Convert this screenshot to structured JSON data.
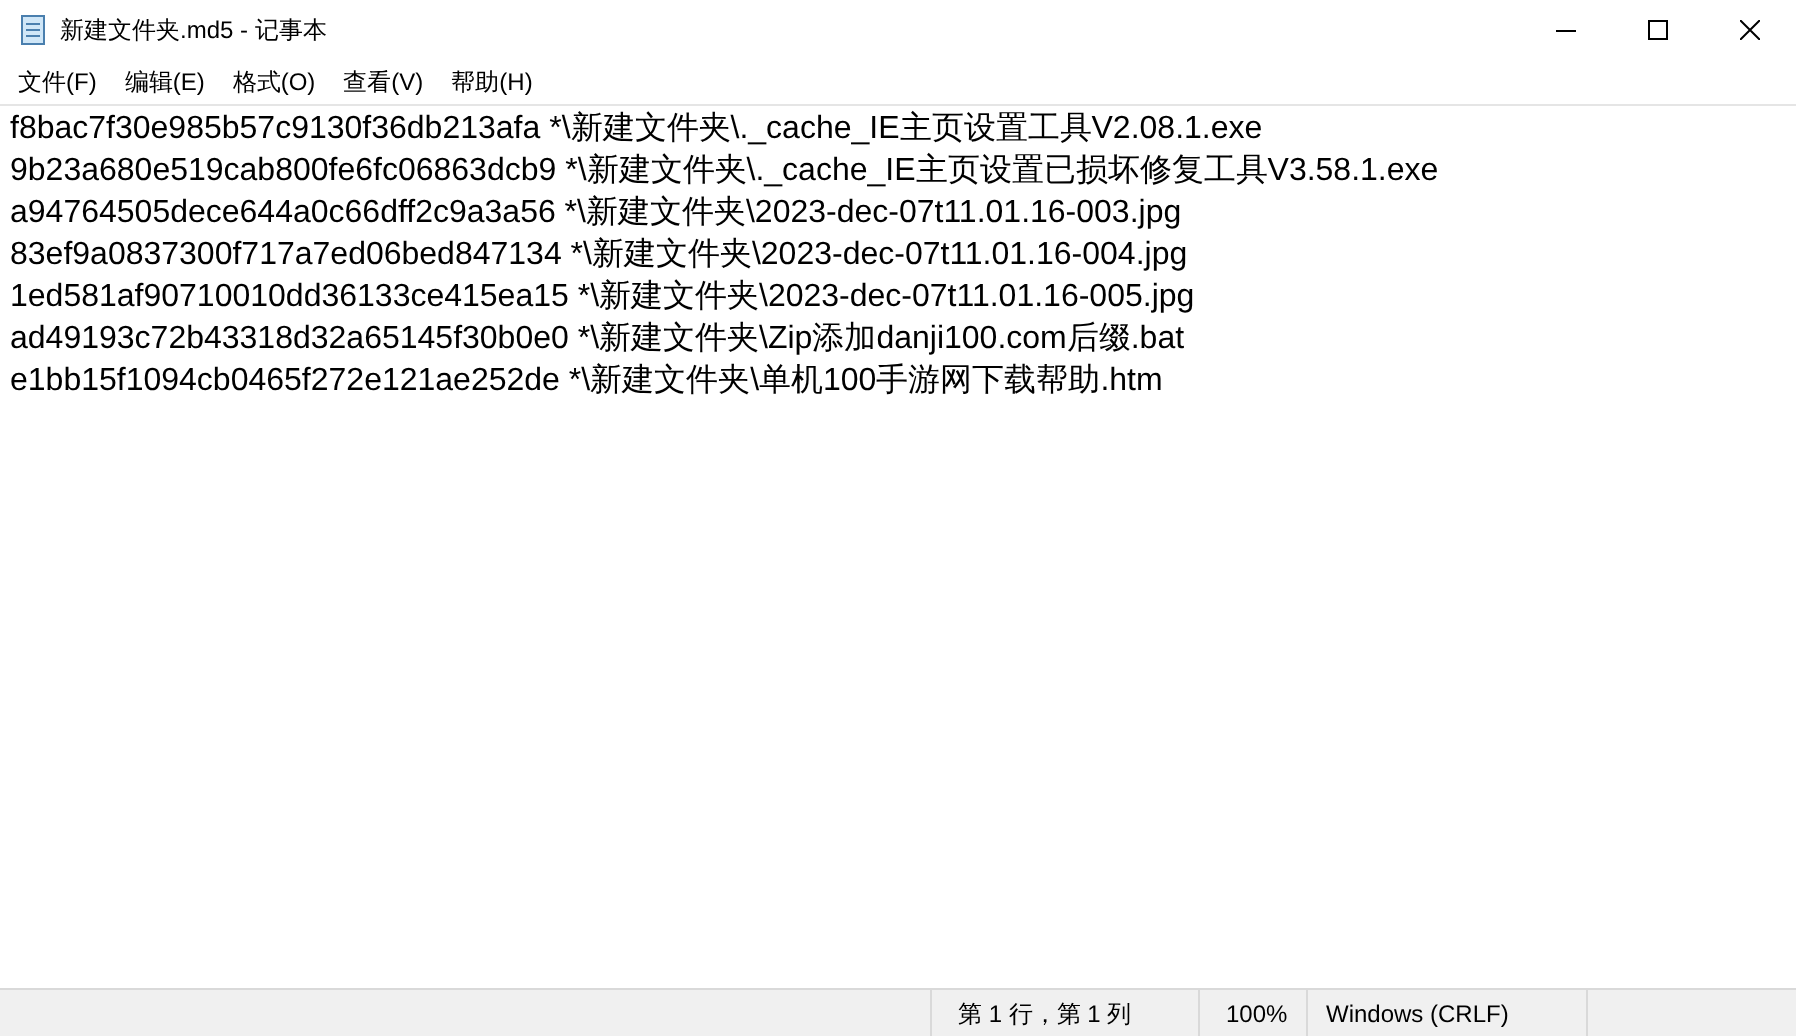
{
  "window": {
    "title": "新建文件夹.md5 - 记事本"
  },
  "menu": [
    "文件(F)",
    "编辑(E)",
    "格式(O)",
    "查看(V)",
    "帮助(H)"
  ],
  "lines": [
    "f8bac7f30e985b57c9130f36db213afa *\\新建文件夹\\._cache_IE主页设置工具V2.08.1.exe",
    "9b23a680e519cab800fe6fc06863dcb9 *\\新建文件夹\\._cache_IE主页设置已损坏修复工具V3.58.1.exe",
    "a94764505dece644a0c66dff2c9a3a56 *\\新建文件夹\\2023-dec-07t11.01.16-003.jpg",
    "83ef9a0837300f717a7ed06bed847134 *\\新建文件夹\\2023-dec-07t11.01.16-004.jpg",
    "1ed581af90710010dd36133ce415ea15 *\\新建文件夹\\2023-dec-07t11.01.16-005.jpg",
    "ad49193c72b43318d32a65145f30b0e0 *\\新建文件夹\\Zip添加danji100.com后缀.bat",
    "e1bb15f1094cb0465f272e121ae252de *\\新建文件夹\\单机100手游网下载帮助.htm"
  ],
  "status_bar": {
    "position": "第 1 行，第 1 列",
    "zoom": "100%",
    "line_ending": "Windows (CRLF)"
  }
}
